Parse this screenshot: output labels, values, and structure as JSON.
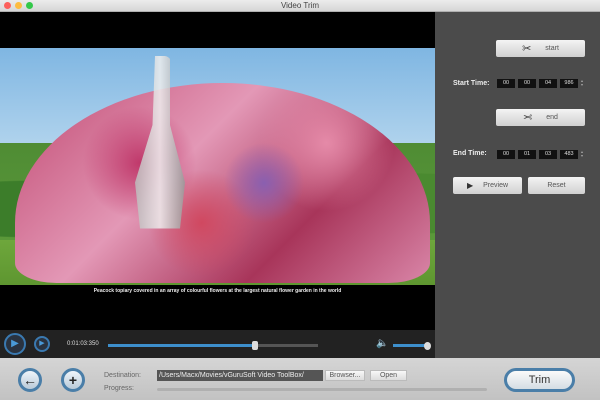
{
  "window": {
    "title": "Video Trim"
  },
  "video": {
    "caption": "Peacock topiary covered in an array of colourful flowers at the largest natural flower garden in the world"
  },
  "player": {
    "current_time": "0:01:03:350",
    "seek_fraction": 0.7,
    "volume_fraction": 1.0
  },
  "panel": {
    "start_button": "start",
    "start_time_label": "Start Time:",
    "start_time": [
      "00",
      "00",
      "04",
      "986"
    ],
    "end_button": "end",
    "end_time_label": "End Time:",
    "end_time": [
      "00",
      "01",
      "03",
      "483"
    ],
    "preview_button": "Preview",
    "reset_button": "Reset"
  },
  "bottom": {
    "destination_label": "Destination:",
    "destination_value": "/Users/Macx/Movies/vGuruSoft Video ToolBox/",
    "browser_button": "Browser...",
    "open_button": "Open",
    "progress_label": "Progress:",
    "progress_fraction": 0,
    "trim_button": "Trim"
  },
  "colors": {
    "accent": "#3d8fcc",
    "panel": "#4b4b4b"
  }
}
